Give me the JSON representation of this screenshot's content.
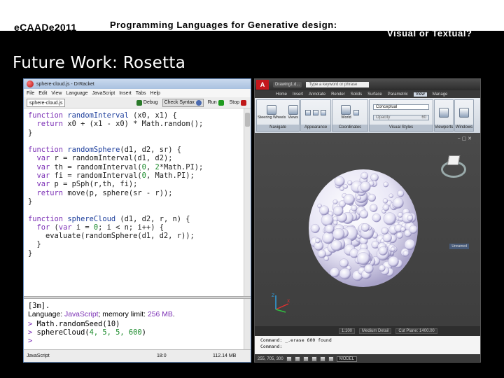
{
  "slide": {
    "brand_main": "eCAADe",
    "brand_year": "2011",
    "title_part1": "Programming Languages for Generative design:",
    "title_part2": "Visual or Textual?",
    "heading": "Future Work: Rosetta"
  },
  "drracket": {
    "window_title": "sphere-cloud.js - DrRacket",
    "menu": [
      "File",
      "Edit",
      "View",
      "Language",
      "JavaScript",
      "Insert",
      "Tabs",
      "Help"
    ],
    "file_selector": "sphere-cloud.js",
    "toolbar": {
      "debug": "Debug",
      "check_syntax": "Check Syntax",
      "run": "Run",
      "stop": "Stop"
    },
    "code_lines": [
      [
        [
          "kw",
          "function "
        ],
        [
          "fn",
          "randomInterval"
        ],
        [
          "pl",
          " (x0, x1) {"
        ]
      ],
      [
        [
          "pl",
          "  "
        ],
        [
          "kw",
          "return"
        ],
        [
          "pl",
          " x0 + (x1 - x0) * Math.random();"
        ]
      ],
      [
        [
          "pl",
          "}"
        ]
      ],
      [
        [
          "pl",
          ""
        ]
      ],
      [
        [
          "kw",
          "function "
        ],
        [
          "fn",
          "randomSphere"
        ],
        [
          "pl",
          "(d1, d2, sr) {"
        ]
      ],
      [
        [
          "pl",
          "  "
        ],
        [
          "kw",
          "var"
        ],
        [
          "pl",
          " r = randomInterval(d1, d2);"
        ]
      ],
      [
        [
          "pl",
          "  "
        ],
        [
          "kw",
          "var"
        ],
        [
          "pl",
          " th = randomInterval("
        ],
        [
          "num",
          "0"
        ],
        [
          "pl",
          ", "
        ],
        [
          "num",
          "2"
        ],
        [
          "pl",
          "*Math.PI);"
        ]
      ],
      [
        [
          "pl",
          "  "
        ],
        [
          "kw",
          "var"
        ],
        [
          "pl",
          " fi = randomInterval("
        ],
        [
          "num",
          "0"
        ],
        [
          "pl",
          ", Math.PI);"
        ]
      ],
      [
        [
          "pl",
          "  "
        ],
        [
          "kw",
          "var"
        ],
        [
          "pl",
          " p = pSph(r,th, fi);"
        ]
      ],
      [
        [
          "pl",
          "  "
        ],
        [
          "kw",
          "return"
        ],
        [
          "pl",
          " move(p, sphere(sr - r));"
        ]
      ],
      [
        [
          "pl",
          "}"
        ]
      ],
      [
        [
          "pl",
          ""
        ]
      ],
      [
        [
          "kw",
          "function "
        ],
        [
          "fn",
          "sphereCloud"
        ],
        [
          "pl",
          " (d1, d2, r, n) {"
        ]
      ],
      [
        [
          "pl",
          "  "
        ],
        [
          "kw",
          "for"
        ],
        [
          "pl",
          " ("
        ],
        [
          "kw",
          "var"
        ],
        [
          "pl",
          " i = "
        ],
        [
          "num",
          "0"
        ],
        [
          "pl",
          "; i < n; i++) {"
        ]
      ],
      [
        [
          "pl",
          "    evaluate(randomSphere(d1, d2, r));"
        ]
      ],
      [
        [
          "pl",
          "  }"
        ]
      ],
      [
        [
          "pl",
          "}"
        ]
      ]
    ],
    "repl": {
      "line1": "[3m].",
      "lang_label": "Language: ",
      "lang_name": "JavaScript",
      "mem_label": "; memory limit: ",
      "mem_value": "256 MB",
      "mem_end": ".",
      "prompt": "> ",
      "cmd1": "Math.randomSeed(10)",
      "cmd2_pre": "sphereCloud(",
      "cmd2_args": "4, 5, 5, 600",
      "cmd2_post": ")",
      "prompt_empty": ">"
    },
    "status": {
      "language": "JavaScript",
      "position": "18:0",
      "memory": "112.14 MB"
    }
  },
  "autocad": {
    "doc_tab": "Drawing1.d...",
    "search_placeholder": "Type a keyword or phrase",
    "ribbon_tabs": [
      "Home",
      "Insert",
      "Annotate",
      "Render",
      "Solids",
      "Surface",
      "Parametric",
      "View",
      "Manage"
    ],
    "active_tab": "View",
    "panels": {
      "navigate": {
        "label": "Navigate",
        "steering": "Steering Wheels",
        "views": "Views"
      },
      "appearance": {
        "label": "Appearance"
      },
      "coordinates": {
        "label": "Coordinates",
        "world": "World"
      },
      "visual_styles": {
        "label": "Visual Styles",
        "style": "Conceptual",
        "opacity_label": "Opacity",
        "opacity_value": "60"
      },
      "viewports": {
        "label": "Viewports"
      },
      "windows": {
        "label": "Windows"
      }
    },
    "viewcube_label": "Unnamed",
    "layouts": {
      "scale": "1:100",
      "detail": "Medium Detail",
      "cut_plane": "Cut Plane: 1400.00"
    },
    "command": {
      "line1": "Command:  _.erase 600 found",
      "line2": "Command:"
    },
    "status": {
      "coords": "255, 705, 300",
      "model": "MODEL"
    }
  },
  "colors": {
    "accent_red": "#c4161c",
    "keyword": "#7b2fb5",
    "function": "#1c3d9b",
    "number": "#1a8a2a"
  }
}
